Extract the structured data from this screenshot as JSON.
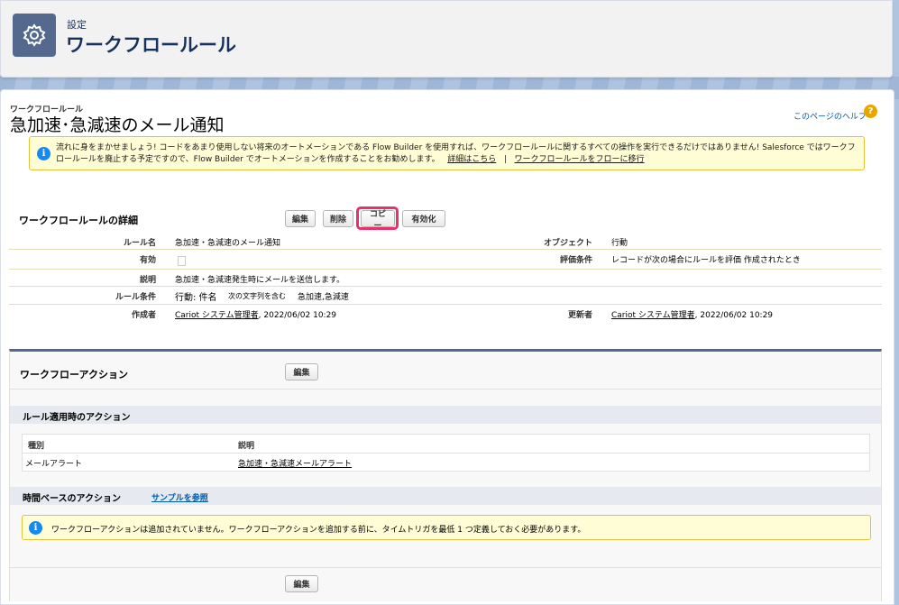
{
  "header": {
    "eyebrow": "設定",
    "title": "ワークフロールール",
    "icon": "gear-icon"
  },
  "page": {
    "eyebrow": "ワークフロールール",
    "title": "急加速･急減速のメール通知",
    "help_link": "このページのヘルプ",
    "help_icon": "?"
  },
  "info_banner": {
    "icon": "i",
    "text": "流れに身をまかせましょう! コードをあまり使用しない将来のオートメーションである Flow Builder を使用すれば、ワークフロールールに関するすべての操作を実行できるだけではありません! Salesforce ではワークフロールールを廃止する予定ですので、Flow Builder でオートメーションを作成することをお勧めします。",
    "link1": "詳細はこちら",
    "separator": "|",
    "link2": "ワークフロールールをフローに移行"
  },
  "detail": {
    "section_title": "ワークフロールールの詳細",
    "buttons": {
      "edit": "編集",
      "delete": "削除",
      "copy": "コピー",
      "activate": "有効化"
    },
    "rows": {
      "rule_name_label": "ルール名",
      "rule_name_value": "急加速・急減速のメール通知",
      "object_label": "オブジェクト",
      "object_value": "行動",
      "active_label": "有効",
      "eval_label": "評価条件",
      "eval_value": "レコードが次の場合にルールを評価 作成されたとき",
      "desc_label": "説明",
      "desc_value": "急加速・急減速発生時にメールを送信します。",
      "criteria_label": "ルール条件",
      "criteria_prefix": "行動: 件名",
      "criteria_op": "次の文字列を含む",
      "criteria_value": "急加速,急減速",
      "created_label": "作成者",
      "created_user": "Cariot システム管理者",
      "created_date": ", 2022/06/02 10:29",
      "modified_label": "更新者",
      "modified_user": "Cariot システム管理者",
      "modified_date": ", 2022/06/02 10:29"
    }
  },
  "workflow_actions": {
    "section_title": "ワークフローアクション",
    "edit_button": "編集",
    "immediate": {
      "title": "ルール適用時のアクション",
      "col_type": "種別",
      "col_desc": "説明",
      "rows": [
        {
          "type": "メールアラート",
          "desc": "急加速・急減速メールアラート"
        }
      ]
    },
    "time_based": {
      "title": "時間ベースのアクション",
      "sample_link": "サンプルを参照",
      "info_icon": "i",
      "info_text": "ワークフローアクションは追加されていません。ワークフローアクションを追加する前に、タイムトリガを最低 1 つ定義しておく必要があります。"
    },
    "bottom_edit_button": "編集"
  },
  "colors": {
    "highlight": "#e8306a",
    "header_icon_bg": "#54698d",
    "link": "#015ba7"
  }
}
